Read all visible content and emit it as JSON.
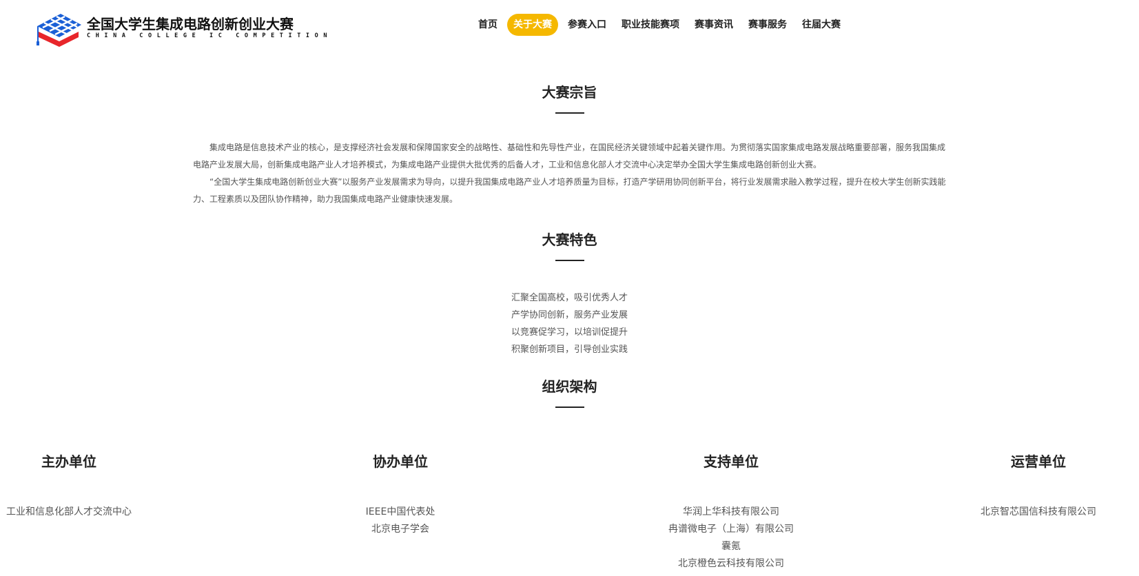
{
  "header": {
    "logo_cn": "全国大学生集成电路创新创业大赛",
    "logo_en": "CHINA COLLEGE IC COMPETITION"
  },
  "nav": {
    "items": [
      {
        "label": "首页"
      },
      {
        "label": "关于大赛",
        "active": true
      },
      {
        "label": "参赛入口"
      },
      {
        "label": "职业技能赛项"
      },
      {
        "label": "赛事资讯"
      },
      {
        "label": "赛事服务"
      },
      {
        "label": "往届大赛"
      }
    ]
  },
  "purpose": {
    "title": "大赛宗旨",
    "paragraphs": [
      "集成电路是信息技术产业的核心，是支撑经济社会发展和保障国家安全的战略性、基础性和先导性产业，在国民经济关键领域中起着关键作用。为贯彻落实国家集成电路发展战略重要部署，服务我国集成电路产业发展大局，创新集成电路产业人才培养模式，为集成电路产业提供大批优秀的后备人才，工业和信息化部人才交流中心决定举办全国大学生集成电路创新创业大赛。",
      "“全国大学生集成电路创新创业大赛”以服务产业发展需求为导向，以提升我国集成电路产业人才培养质量为目标，打造产学研用协同创新平台，将行业发展需求融入教学过程，提升在校大学生创新实践能力、工程素质以及团队协作精神，助力我国集成电路产业健康快速发展。"
    ]
  },
  "features": {
    "title": "大赛特色",
    "lines": [
      "汇聚全国高校，吸引优秀人才",
      "产学协同创新，服务产业发展",
      "以竞赛促学习，以培训促提升",
      "积聚创新项目，引导创业实践"
    ]
  },
  "organization": {
    "title": "组织架构",
    "groups": [
      {
        "title": "主办单位",
        "members": [
          "工业和信息化部人才交流中心"
        ]
      },
      {
        "title": "协办单位",
        "members": [
          "IEEE中国代表处",
          "北京电子学会"
        ]
      },
      {
        "title": "支持单位",
        "members": [
          "华润上华科技有限公司",
          "冉谱微电子（上海）有限公司",
          "囊氪",
          "北京橙色云科技有限公司"
        ]
      },
      {
        "title": "运营单位",
        "members": [
          "北京智芯国信科技有限公司"
        ]
      }
    ]
  },
  "colors": {
    "accent": "#f5b800",
    "logo_blue": "#1a5fd6",
    "logo_red": "#e8262b"
  },
  "icons": {
    "logo": "graduation-cap-chip-logo-icon"
  }
}
